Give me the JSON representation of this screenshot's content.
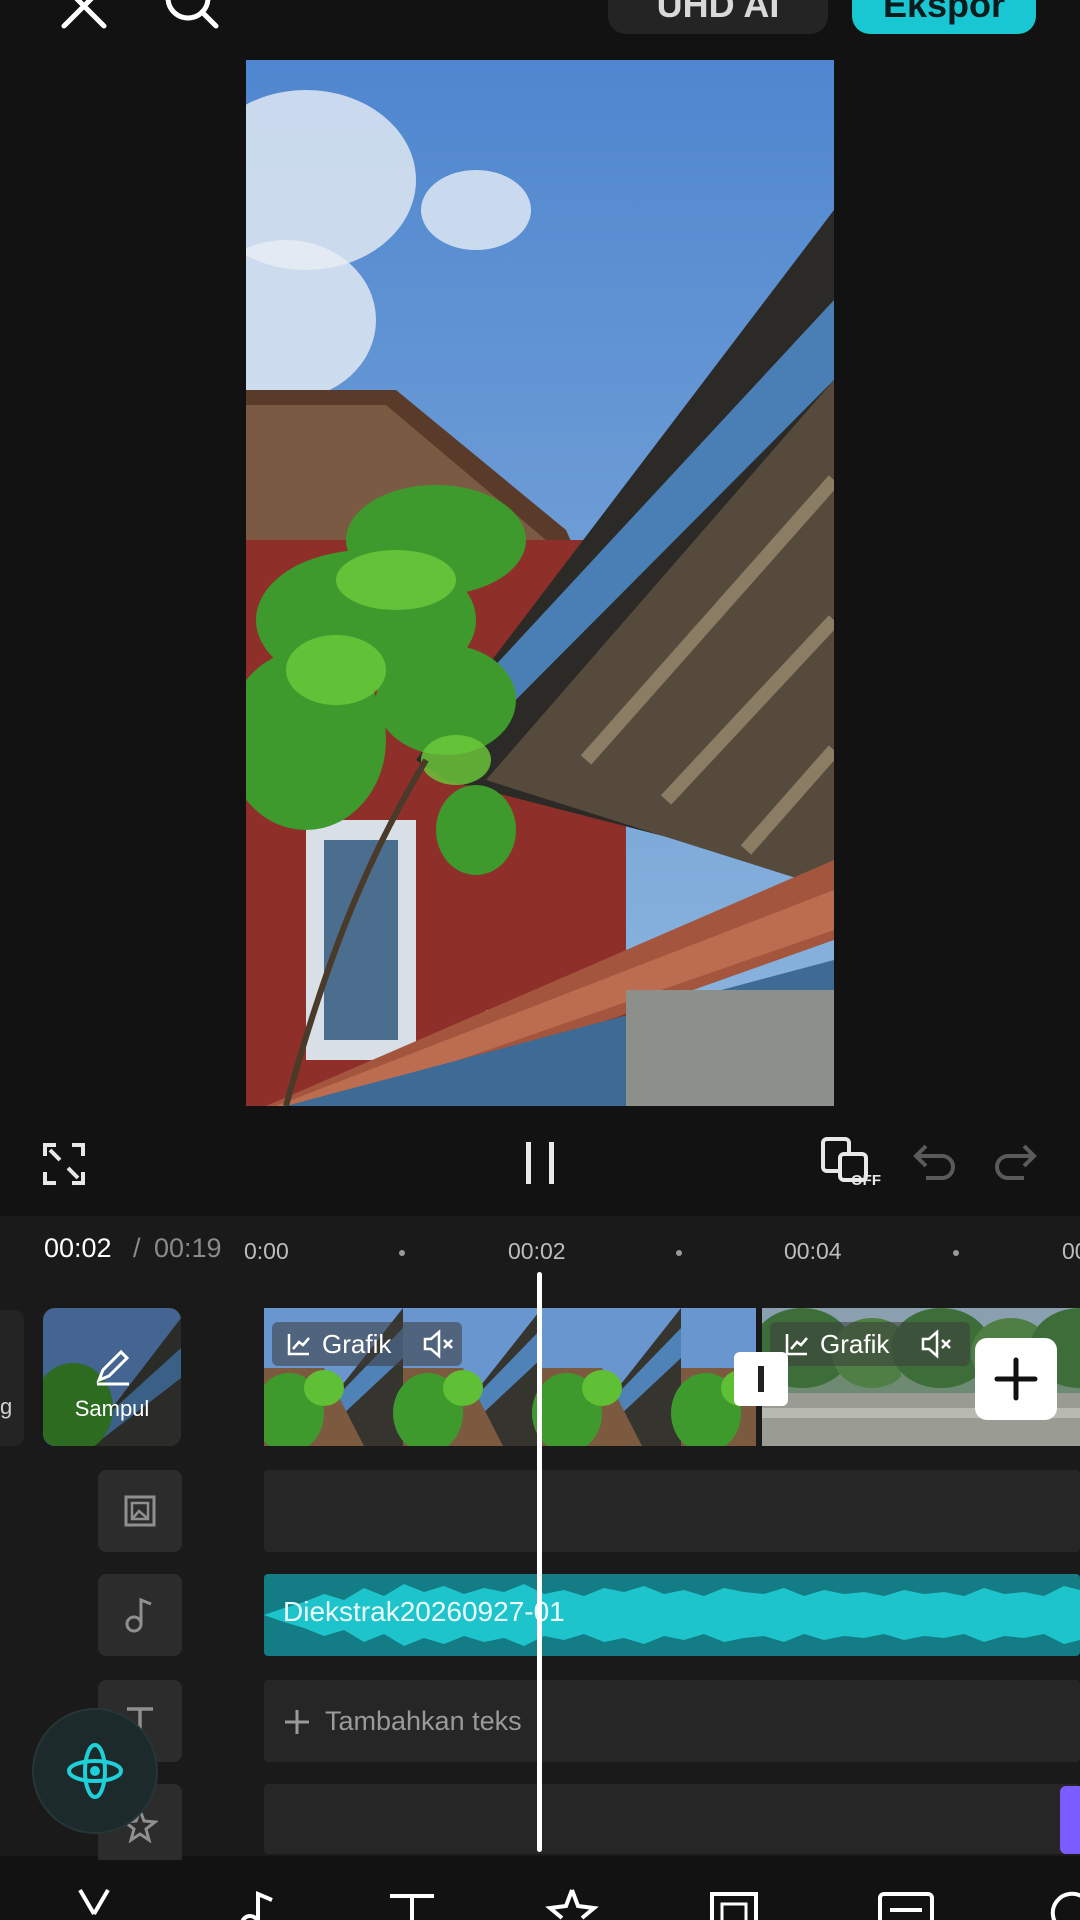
{
  "header": {
    "close_icon": "close-icon",
    "search_icon": "search-icon",
    "ai_button_label": "UHD AI",
    "export_button_label": "Ekspor",
    "accent_color": "#19c7d2"
  },
  "preview": {
    "description_icon": "video-frame"
  },
  "controls": {
    "fullscreen_icon": "fullscreen-icon",
    "pause_icon": "pause-icon",
    "sync_toggle_badge": "OFF",
    "undo_icon": "undo-icon",
    "redo_icon": "redo-icon"
  },
  "timeline": {
    "current_time": "00:02",
    "separator": "/",
    "total_time": "00:19",
    "ruler": [
      "0:00",
      "00:02",
      "00:04",
      "00"
    ],
    "cover_label": "Sampul",
    "left_cut_label": "g",
    "clips": [
      {
        "label": "Grafik",
        "muted_icon": "mute-icon"
      },
      {
        "label": "Grafik",
        "muted_icon": "mute-icon"
      }
    ],
    "audio_track_label": "Diekstrak20260927-01",
    "add_text_label": "Tambahkan teks"
  },
  "bottom_toolbar": {
    "icons": [
      "cut-icon",
      "audio-icon",
      "text-icon",
      "sticker-icon",
      "overlay-icon",
      "caption-icon",
      "effect-icon"
    ]
  }
}
